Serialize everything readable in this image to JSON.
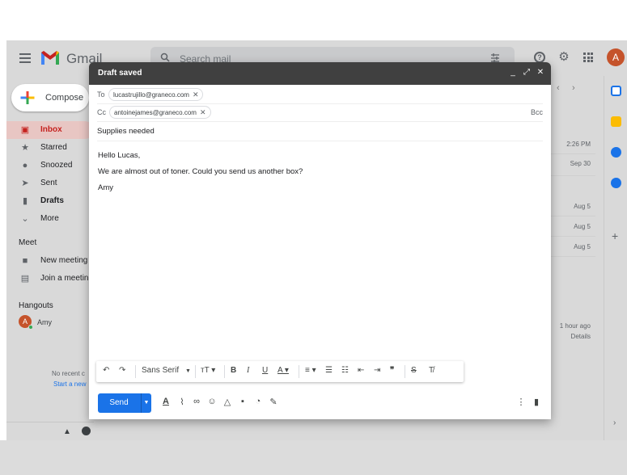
{
  "app": {
    "brand": "Gmail"
  },
  "search": {
    "placeholder": "Search mail"
  },
  "account": {
    "initial": "A"
  },
  "sidebar": {
    "compose_label": "Compose",
    "items": [
      {
        "label": "Inbox",
        "icon": "inbox-icon"
      },
      {
        "label": "Starred",
        "icon": "star-icon"
      },
      {
        "label": "Snoozed",
        "icon": "clock-icon"
      },
      {
        "label": "Sent",
        "icon": "send-icon"
      },
      {
        "label": "Drafts",
        "icon": "draft-icon"
      },
      {
        "label": "More",
        "icon": "chevron-down-icon"
      }
    ],
    "meet_heading": "Meet",
    "meet_items": [
      {
        "label": "New meeting",
        "icon": "video-icon"
      },
      {
        "label": "Join a meetin",
        "icon": "keyboard-icon"
      }
    ],
    "hangouts_heading": "Hangouts",
    "hangouts_user": {
      "initial": "A",
      "name": "Amy"
    },
    "no_recent": "No recent c",
    "start_new": "Start a new"
  },
  "mail_list": {
    "dates": [
      "2:26 PM",
      "Sep 30",
      "Aug 5",
      "Aug 5",
      "Aug 5",
      "1 hour ago",
      "Details"
    ]
  },
  "compose": {
    "title": "Draft saved",
    "to_label": "To",
    "to_recipient": "lucastrujillo@graneco.com",
    "cc_label": "Cc",
    "cc_recipient": "antoinejames@graneco.com",
    "bcc_label": "Bcc",
    "subject": "Supplies needed",
    "body": [
      "Hello Lucas,",
      "We are almost out of toner. Could you send us another box?",
      "Amy"
    ],
    "font_name": "Sans Serif",
    "send_label": "Send"
  },
  "colors": {
    "accent": "#1a73e8",
    "header": "#404040",
    "inbox_active": "#c5221f"
  }
}
